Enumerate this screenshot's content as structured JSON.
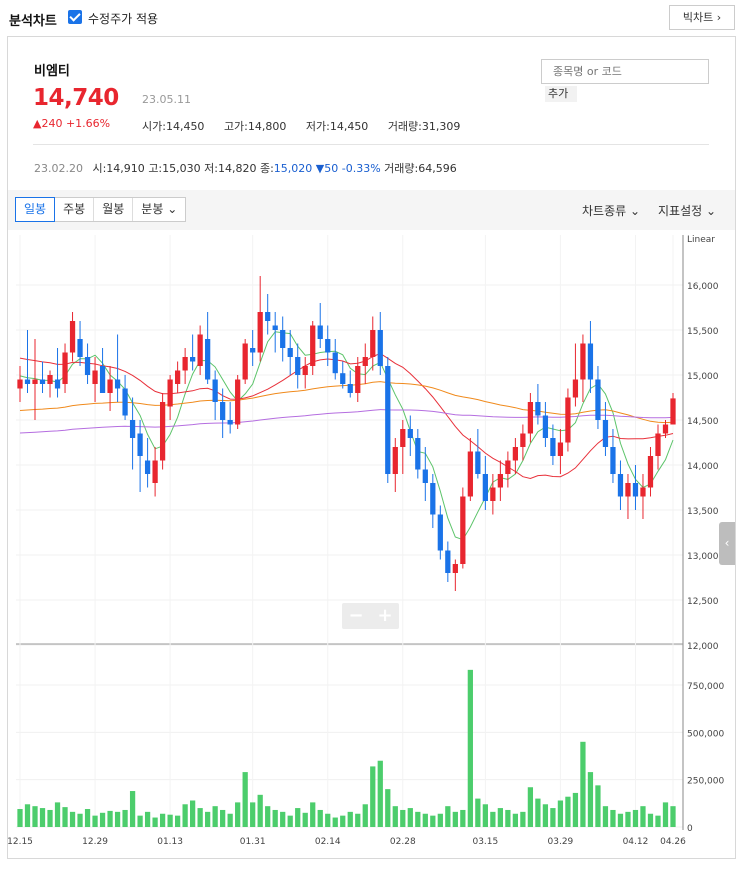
{
  "header": {
    "title": "분석차트",
    "adjusted_checkbox_label": "수정주가 적용",
    "adjusted_checked": true,
    "big_chart_button": "빅차트"
  },
  "stock": {
    "name": "비엠티",
    "price": "14,740",
    "date": "23.05.11",
    "change": "240 +1.66%",
    "open": "시가:14,450",
    "high": "고가:14,800",
    "low": "저가:14,450",
    "volume": "거래량:31,309",
    "search_placeholder": "종목명 or 코드",
    "add_button": "추가"
  },
  "hover": {
    "date": "23.02.20",
    "open": "시:14,910",
    "high": "고:15,030",
    "low": "저:14,820",
    "close_label": "종:",
    "close_value": "15,020",
    "change": "▼50 -0.33%",
    "volume": "거래량:64,596"
  },
  "toolbar": {
    "tabs": [
      "일봉",
      "주봉",
      "월봉",
      "분봉"
    ],
    "active_tab": "일봉",
    "chart_type": "차트종류",
    "indicator": "지표설정"
  },
  "colors": {
    "up": "#e8262f",
    "down": "#1a73e8",
    "ma5": "#5cc46a",
    "ma20": "#e8303a",
    "ma60": "#f08a1c",
    "ma120": "#b56ee0",
    "volume": "#4ccd6c"
  },
  "chart_data": {
    "type": "candlestick",
    "scale_label": "Linear",
    "price_axis": {
      "ticks": [
        "16,000",
        "15,500",
        "15,000",
        "14,500",
        "14,000",
        "13,500",
        "13,000",
        "12,500",
        "12,000"
      ]
    },
    "volume_axis": {
      "ticks": [
        "750,000",
        "500,000",
        "250,000",
        "0"
      ]
    },
    "x_ticks": [
      "12.15",
      "12.29",
      "01.13",
      "01.31",
      "02.14",
      "02.28",
      "03.15",
      "03.29",
      "04.12",
      "04.26"
    ],
    "candles_ohlc": [
      [
        14850,
        15100,
        14700,
        14950
      ],
      [
        14950,
        15500,
        14800,
        14900
      ],
      [
        14900,
        15400,
        14500,
        14950
      ],
      [
        14950,
        15150,
        14800,
        14900
      ],
      [
        14900,
        15050,
        14750,
        15000
      ],
      [
        14950,
        15300,
        14750,
        14850
      ],
      [
        14900,
        15350,
        14800,
        15250
      ],
      [
        15250,
        15700,
        15150,
        15600
      ],
      [
        15400,
        15600,
        15100,
        15200
      ],
      [
        15200,
        15350,
        14900,
        15000
      ],
      [
        14900,
        15200,
        14700,
        15050
      ],
      [
        15100,
        15300,
        14800,
        14800
      ],
      [
        14800,
        15100,
        14600,
        14950
      ],
      [
        14950,
        15450,
        14700,
        14850
      ],
      [
        14850,
        15000,
        14500,
        14550
      ],
      [
        14500,
        14750,
        13950,
        14300
      ],
      [
        14350,
        14500,
        13700,
        14100
      ],
      [
        14050,
        14300,
        13750,
        13900
      ],
      [
        13800,
        14200,
        13650,
        14050
      ],
      [
        14050,
        14800,
        13950,
        14700
      ],
      [
        14650,
        15000,
        14500,
        14950
      ],
      [
        14900,
        15150,
        14800,
        15050
      ],
      [
        15050,
        15300,
        14900,
        15200
      ],
      [
        15200,
        15450,
        15050,
        15150
      ],
      [
        15100,
        15550,
        15000,
        15450
      ],
      [
        15400,
        15700,
        14900,
        14950
      ],
      [
        14950,
        15050,
        14500,
        14700
      ],
      [
        14700,
        14850,
        14300,
        14500
      ],
      [
        14500,
        14700,
        14350,
        14450
      ],
      [
        14450,
        15000,
        14400,
        14950
      ],
      [
        14950,
        15400,
        14900,
        15350
      ],
      [
        15300,
        15500,
        15100,
        15250
      ],
      [
        15250,
        16100,
        15150,
        15700
      ],
      [
        15700,
        15900,
        15450,
        15600
      ],
      [
        15550,
        15700,
        15250,
        15500
      ],
      [
        15500,
        15650,
        15150,
        15300
      ],
      [
        15300,
        15500,
        15000,
        15200
      ],
      [
        15200,
        15350,
        14850,
        15000
      ],
      [
        15000,
        15200,
        14850,
        15100
      ],
      [
        15100,
        15600,
        15000,
        15550
      ],
      [
        15550,
        15800,
        15300,
        15400
      ],
      [
        15400,
        15550,
        15100,
        15250
      ],
      [
        15250,
        15400,
        14950,
        15020
      ],
      [
        15020,
        15150,
        14850,
        14900
      ],
      [
        14900,
        15050,
        14750,
        14800
      ],
      [
        14800,
        15200,
        14700,
        15100
      ],
      [
        15100,
        15350,
        14900,
        15200
      ],
      [
        15200,
        15650,
        15050,
        15500
      ],
      [
        15500,
        15700,
        15000,
        15100
      ],
      [
        15100,
        15200,
        13800,
        13900
      ],
      [
        13900,
        14300,
        13700,
        14200
      ],
      [
        14200,
        14500,
        13900,
        14400
      ],
      [
        14400,
        14550,
        14100,
        14300
      ],
      [
        14300,
        14400,
        13850,
        13950
      ],
      [
        13950,
        14200,
        13600,
        13800
      ],
      [
        13800,
        13900,
        13300,
        13450
      ],
      [
        13450,
        13550,
        12950,
        13050
      ],
      [
        13050,
        13150,
        12700,
        12800
      ],
      [
        12800,
        12950,
        12600,
        12900
      ],
      [
        12900,
        13750,
        12850,
        13650
      ],
      [
        13650,
        14300,
        13600,
        14150
      ],
      [
        14150,
        14400,
        13850,
        13900
      ],
      [
        13900,
        14100,
        13500,
        13600
      ],
      [
        13600,
        13900,
        13450,
        13750
      ],
      [
        13750,
        14050,
        13600,
        13900
      ],
      [
        13900,
        14150,
        13750,
        14050
      ],
      [
        14050,
        14300,
        13900,
        14200
      ],
      [
        14200,
        14450,
        14050,
        14350
      ],
      [
        14350,
        14800,
        14250,
        14700
      ],
      [
        14700,
        14900,
        14450,
        14550
      ],
      [
        14550,
        14700,
        14200,
        14300
      ],
      [
        14300,
        14450,
        14000,
        14100
      ],
      [
        14100,
        14400,
        13900,
        14250
      ],
      [
        14250,
        14850,
        14150,
        14750
      ],
      [
        14750,
        15350,
        14650,
        14950
      ],
      [
        14950,
        15450,
        14700,
        15350
      ],
      [
        15350,
        15600,
        14800,
        14950
      ],
      [
        14950,
        15100,
        14400,
        14500
      ],
      [
        14500,
        14700,
        14100,
        14200
      ],
      [
        14200,
        14400,
        13800,
        13900
      ],
      [
        13900,
        14050,
        13500,
        13650
      ],
      [
        13650,
        13900,
        13400,
        13800
      ],
      [
        13800,
        14000,
        13500,
        13650
      ],
      [
        13650,
        13900,
        13400,
        13750
      ],
      [
        13750,
        14200,
        13650,
        14100
      ],
      [
        14100,
        14450,
        13950,
        14350
      ],
      [
        14350,
        14500,
        14300,
        14450
      ],
      [
        14450,
        14800,
        14450,
        14740
      ]
    ],
    "volume_values": [
      95000,
      120000,
      110000,
      100000,
      90000,
      130000,
      105000,
      80000,
      70000,
      95000,
      60000,
      75000,
      85000,
      80000,
      90000,
      190000,
      60000,
      80000,
      50000,
      70000,
      65000,
      60000,
      120000,
      140000,
      100000,
      80000,
      110000,
      90000,
      70000,
      130000,
      290000,
      130000,
      170000,
      110000,
      90000,
      80000,
      60000,
      100000,
      75000,
      130000,
      90000,
      70000,
      50000,
      60000,
      80000,
      70000,
      120000,
      320000,
      350000,
      200000,
      110000,
      90000,
      100000,
      80000,
      70000,
      60000,
      70000,
      110000,
      80000,
      90000,
      830000,
      150000,
      120000,
      80000,
      100000,
      90000,
      70000,
      80000,
      210000,
      150000,
      120000,
      100000,
      140000,
      160000,
      180000,
      450000,
      290000,
      220000,
      110000,
      90000,
      70000,
      80000,
      90000,
      110000,
      70000,
      60000,
      130000,
      110000
    ]
  }
}
